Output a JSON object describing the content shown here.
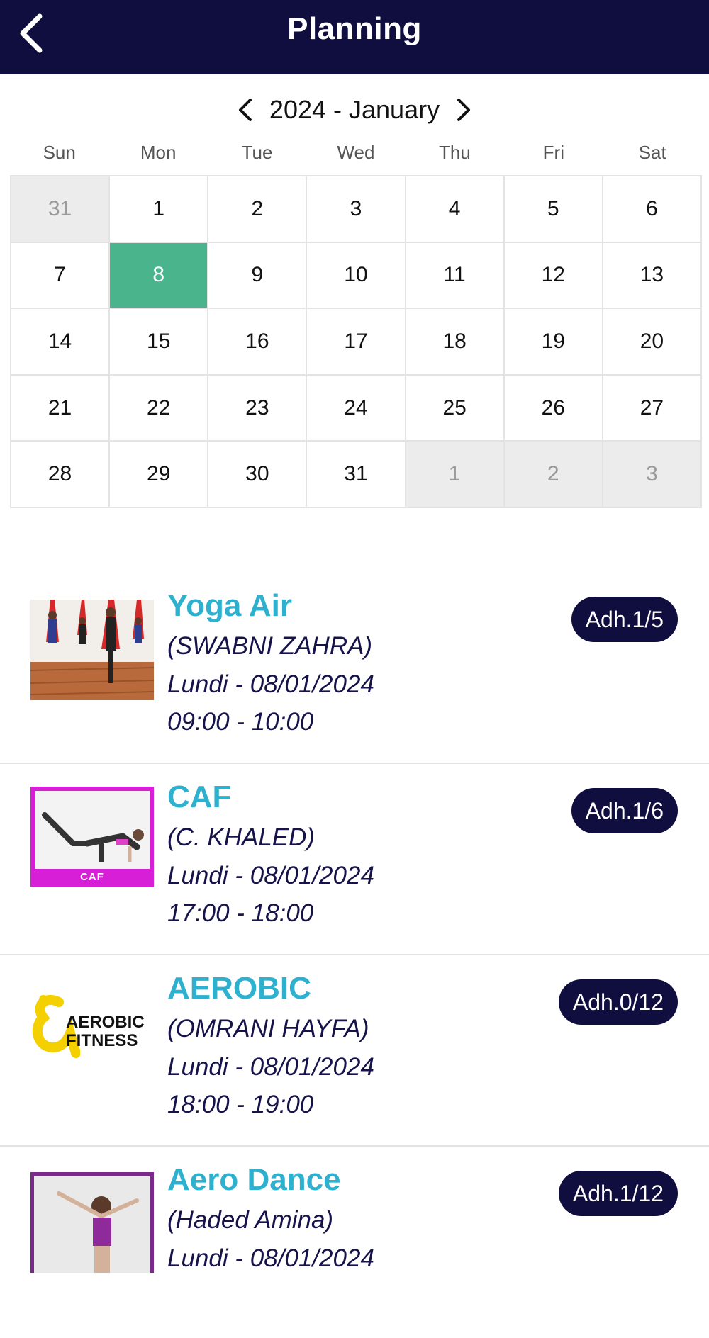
{
  "header": {
    "title": "Planning"
  },
  "calendar": {
    "month_label": "2024 - January",
    "weekdays": [
      "Sun",
      "Mon",
      "Tue",
      "Wed",
      "Thu",
      "Fri",
      "Sat"
    ],
    "days": [
      {
        "label": "31",
        "state": "muted"
      },
      {
        "label": "1",
        "state": "normal"
      },
      {
        "label": "2",
        "state": "normal"
      },
      {
        "label": "3",
        "state": "normal"
      },
      {
        "label": "4",
        "state": "normal"
      },
      {
        "label": "5",
        "state": "normal"
      },
      {
        "label": "6",
        "state": "normal"
      },
      {
        "label": "7",
        "state": "normal"
      },
      {
        "label": "8",
        "state": "selected"
      },
      {
        "label": "9",
        "state": "normal"
      },
      {
        "label": "10",
        "state": "normal"
      },
      {
        "label": "11",
        "state": "normal"
      },
      {
        "label": "12",
        "state": "normal"
      },
      {
        "label": "13",
        "state": "normal"
      },
      {
        "label": "14",
        "state": "normal"
      },
      {
        "label": "15",
        "state": "normal"
      },
      {
        "label": "16",
        "state": "normal"
      },
      {
        "label": "17",
        "state": "normal"
      },
      {
        "label": "18",
        "state": "normal"
      },
      {
        "label": "19",
        "state": "normal"
      },
      {
        "label": "20",
        "state": "normal"
      },
      {
        "label": "21",
        "state": "normal"
      },
      {
        "label": "22",
        "state": "normal"
      },
      {
        "label": "23",
        "state": "normal"
      },
      {
        "label": "24",
        "state": "normal"
      },
      {
        "label": "25",
        "state": "normal"
      },
      {
        "label": "26",
        "state": "normal"
      },
      {
        "label": "27",
        "state": "normal"
      },
      {
        "label": "28",
        "state": "normal"
      },
      {
        "label": "29",
        "state": "normal"
      },
      {
        "label": "30",
        "state": "normal"
      },
      {
        "label": "31",
        "state": "normal"
      },
      {
        "label": "1",
        "state": "muted"
      },
      {
        "label": "2",
        "state": "muted"
      },
      {
        "label": "3",
        "state": "muted"
      }
    ]
  },
  "colors": {
    "header_bg": "#100d3f",
    "selected_day": "#4ab48d",
    "title_accent": "#2eb0cf",
    "badge_bg": "#100d3f"
  },
  "sessions": [
    {
      "title": "Yoga Air",
      "coach": "(SWABNI ZAHRA)",
      "date": "Lundi - 08/01/2024",
      "time": "09:00 - 10:00",
      "badge": "Adh.1/5",
      "image": "yoga-air-photo"
    },
    {
      "title": "CAF",
      "coach": "(C. KHALED)",
      "date": "Lundi - 08/01/2024",
      "time": "17:00 - 18:00",
      "badge": "Adh.1/6",
      "image": "caf-photo",
      "image_caption": "CAF"
    },
    {
      "title": "AEROBIC",
      "coach": "(OMRANI HAYFA)",
      "date": "Lundi - 08/01/2024",
      "time": "18:00 - 19:00",
      "badge": "Adh.0/12",
      "image": "aerobic-fitness-logo",
      "logo_text": [
        "AEROBIC",
        "FITNESS"
      ]
    },
    {
      "title": "Aero Dance",
      "coach": "(Haded Amina)",
      "date": "Lundi - 08/01/2024",
      "time": "",
      "badge": "Adh.1/12",
      "image": "aero-dance-photo"
    }
  ]
}
